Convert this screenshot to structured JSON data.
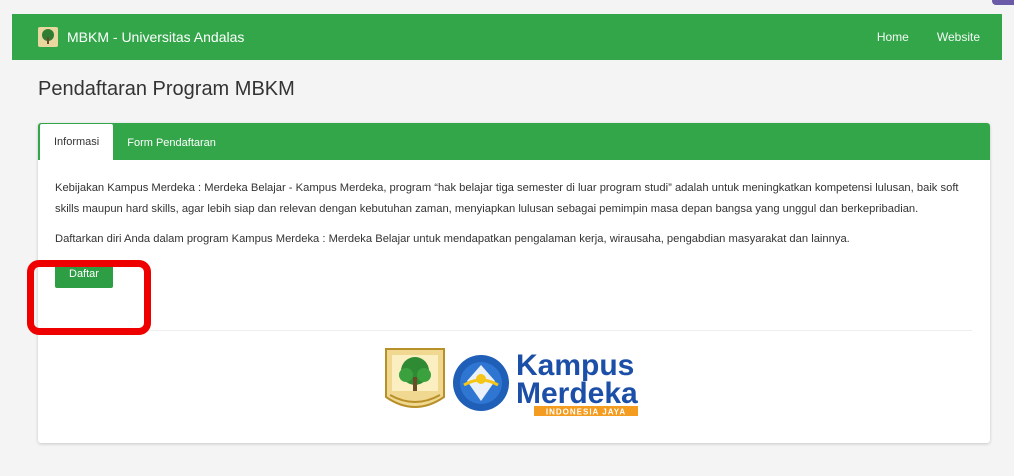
{
  "navbar": {
    "brand": "MBKM - Universitas Andalas",
    "links": [
      "Home",
      "Website"
    ]
  },
  "page": {
    "title": "Pendaftaran Program MBKM"
  },
  "tabs": [
    {
      "label": "Informasi",
      "active": true
    },
    {
      "label": "Form Pendaftaran",
      "active": false
    }
  ],
  "content": {
    "paragraph1": "Kebijakan Kampus Merdeka : Merdeka Belajar - Kampus Merdeka, program “hak belajar tiga semester di luar program studi” adalah untuk meningkatkan kompetensi lulusan, baik soft skills maupun hard skills, agar lebih siap dan relevan dengan kebutuhan zaman, menyiapkan lulusan sebagai pemimpin masa depan bangsa yang unggul dan berkepribadian.",
    "paragraph2": "Daftarkan diri Anda dalam program Kampus Merdeka : Merdeka Belajar untuk mendapatkan pengalaman kerja, wirausaha, pengabdian masyarakat dan lainnya.",
    "button": "Daftar"
  },
  "logo": {
    "line1": "Kampus",
    "line2": "Merdeka",
    "tagline": "INDONESIA JAYA"
  },
  "colors": {
    "primary_green": "#33a64a",
    "highlight_red": "#ee0000",
    "kampus_blue": "#1b4fa8",
    "tagline_orange": "#f39c1f"
  }
}
